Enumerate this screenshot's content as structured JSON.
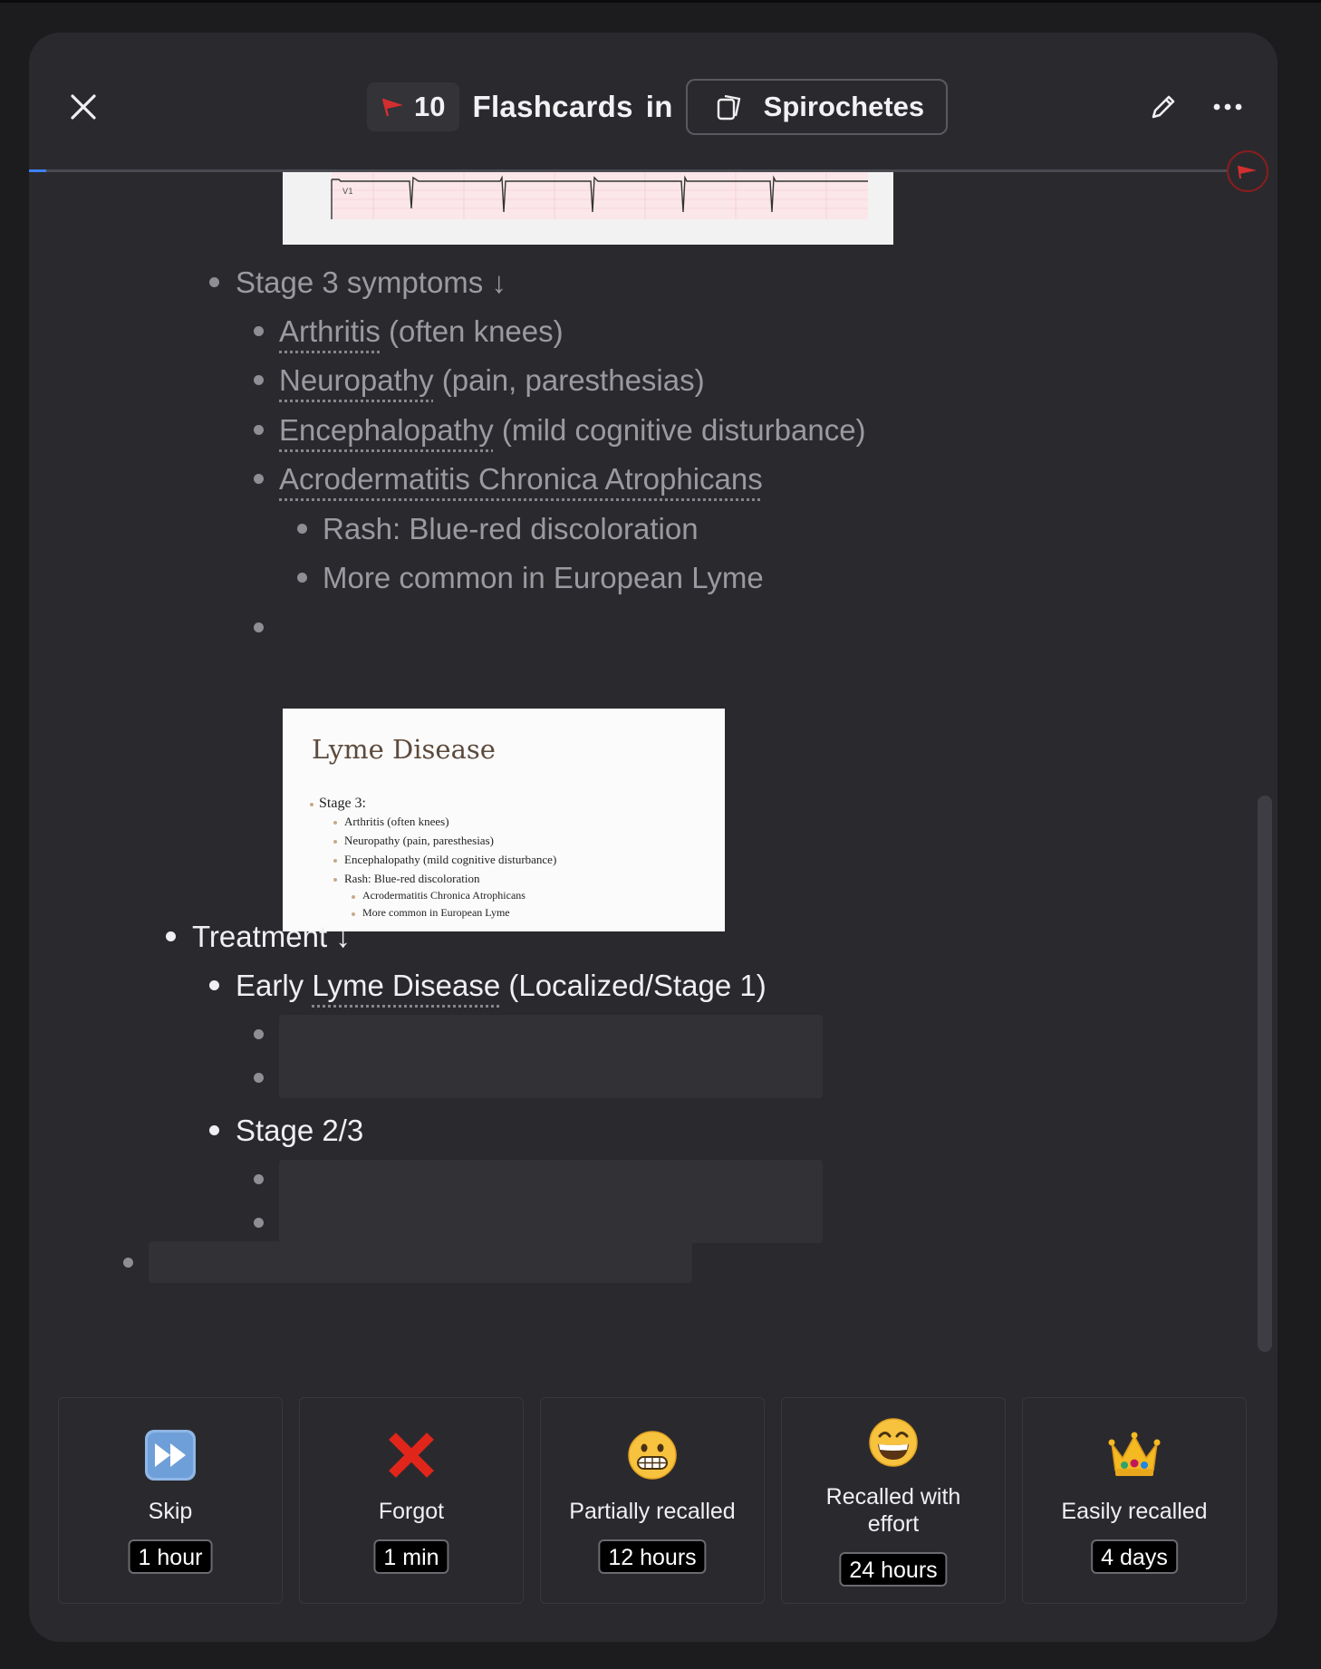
{
  "header": {
    "flag_count": "10",
    "title": "Flashcards",
    "in_word": "in",
    "deck_name": "Spirochetes",
    "progress_fraction": 0.014
  },
  "content": {
    "stage3": {
      "heading": "Stage 3 symptoms ↓",
      "items": [
        {
          "term": "Arthritis",
          "rest": " (often knees)"
        },
        {
          "term": "Neuropathy",
          "rest": " (pain, paresthesias)"
        },
        {
          "term": "Encephalopathy",
          "rest": " (mild cognitive disturbance)"
        },
        {
          "term": "Acrodermatitis Chronica Atrophicans",
          "rest": ""
        }
      ],
      "sub_items": [
        "Rash: Blue-red discoloration",
        "More common in European Lyme"
      ]
    },
    "slide": {
      "title": "Lyme Disease",
      "level1": "Stage 3:",
      "level2": [
        "Arthritis (often knees)",
        "Neuropathy (pain, paresthesias)",
        "Encephalopathy (mild cognitive disturbance)",
        "Rash: Blue-red discoloration"
      ],
      "level3": [
        "Acrodermatitis Chronica Atrophicans",
        "More common in European Lyme"
      ]
    },
    "treatment": {
      "heading": "Treatment ↓",
      "early_pre": "Early ",
      "early_term": "Lyme Disease",
      "early_post": " (Localized/Stage 1)",
      "stage23": "Stage 2/3"
    }
  },
  "answers": [
    {
      "label": "Skip",
      "time": "1 hour",
      "icon": "fast-forward-icon"
    },
    {
      "label": "Forgot",
      "time": "1 min",
      "icon": "cross-mark-icon"
    },
    {
      "label": "Partially recalled",
      "time": "12 hours",
      "icon": "grimacing-face-icon"
    },
    {
      "label_line1": "Recalled with",
      "label_line2": "effort",
      "time": "24 hours",
      "icon": "grinning-face-icon"
    },
    {
      "label": "Easily recalled",
      "time": "4 days",
      "icon": "crown-icon"
    }
  ],
  "colors": {
    "background": "#1c1c1f",
    "panel": "#2a2a2e",
    "flag_red": "#d32f2f",
    "progress_blue": "#3b82f6"
  }
}
